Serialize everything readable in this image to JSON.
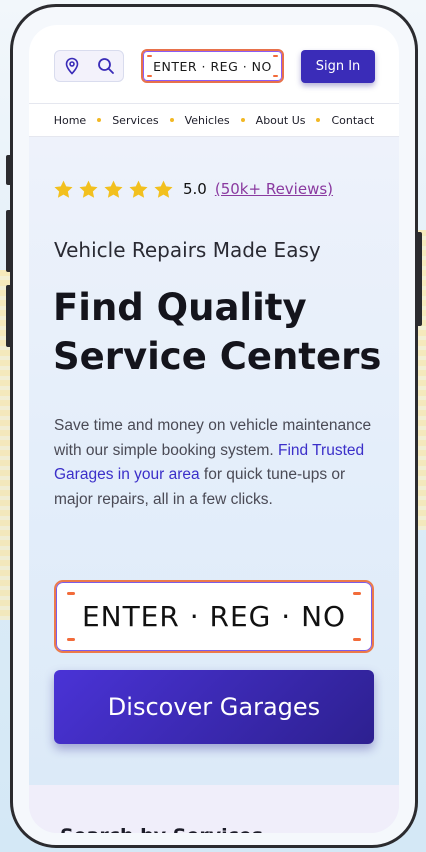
{
  "header": {
    "plate_text": "ENTER · REG · NO",
    "signin_label": "Sign In",
    "icons": [
      "location-pin-icon",
      "search-icon"
    ]
  },
  "nav": {
    "items": [
      "Home",
      "Services",
      "Vehicles",
      "About Us",
      "Contact"
    ]
  },
  "hero": {
    "rating_score": "5.0",
    "rating_reviews": "(50k+ Reviews)",
    "stars": 5,
    "eyebrow": "Vehicle Repairs Made Easy",
    "headline_line1": "Find Quality",
    "headline_line2": "Service Centers",
    "desc_before": "Save time and money on vehicle maintenance with our simple booking system. ",
    "desc_link": "Find Trusted Garages in your area",
    "desc_after": " for quick tune-ups or major repairs, all in a few clicks.",
    "plate_text": "ENTER · REG · NO",
    "cta_label": "Discover Garages"
  },
  "next_section": {
    "title": "Search by Services"
  },
  "colors": {
    "primary": "#3a2cb8",
    "plate_border": "#ec7a4a",
    "star": "#f2c01e",
    "link": "#3b2fc9",
    "reviews_link": "#8a3aa0"
  }
}
